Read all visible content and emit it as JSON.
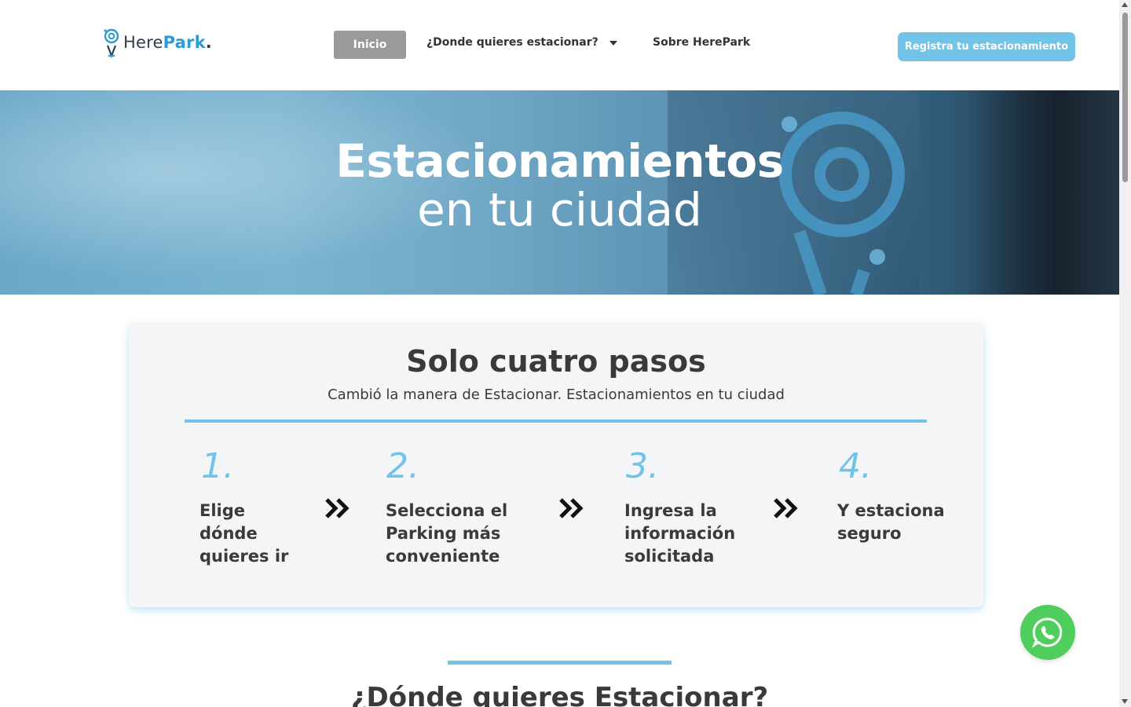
{
  "brand": {
    "logo_here": "Here",
    "logo_park": "Park",
    "logo_dot": ".",
    "accent": "#72c3e8",
    "brand_blue": "#2b9bd6"
  },
  "nav": {
    "home_label": "Inicio",
    "where_label": "¿Donde quieres estacionar?",
    "about_label": "Sobre HerePark",
    "register_label": "Registra tu estacionamiento"
  },
  "hero": {
    "title_line1": "Estacionamientos",
    "title_line2": "en tu ciudad"
  },
  "steps_card": {
    "title": "Solo cuatro pasos",
    "subtitle": "Cambió la manera de Estacionar. Estacionamientos en tu ciudad",
    "steps": [
      {
        "number": "1.",
        "line1": "Elige",
        "line2": "dónde",
        "line3": "quieres ir"
      },
      {
        "number": "2.",
        "line1": "Selecciona el",
        "line2": "Parking más",
        "line3": "conveniente"
      },
      {
        "number": "3.",
        "line1": "Ingresa la",
        "line2": "información",
        "line3": "solicitada"
      },
      {
        "number": "4.",
        "line1": "Y estaciona",
        "line2": "seguro",
        "line3": ""
      }
    ]
  },
  "next_section": {
    "title": "¿Dónde quieres Estacionar?"
  },
  "icons": {
    "whatsapp": "whatsapp-icon",
    "step_arrow": "double-chevron-right-icon",
    "dropdown": "caret-down-icon"
  }
}
